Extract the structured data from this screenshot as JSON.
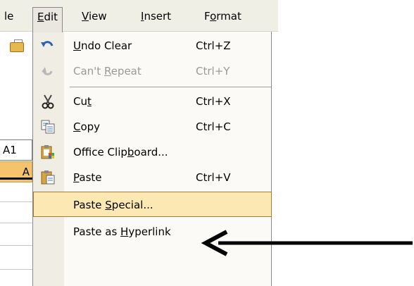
{
  "menubar": {
    "items": [
      {
        "pre": "le",
        "ul": "",
        "post": ""
      },
      {
        "pre": "",
        "ul": "E",
        "post": "dit"
      },
      {
        "pre": "",
        "ul": "V",
        "post": "iew"
      },
      {
        "pre": "",
        "ul": "I",
        "post": "nsert"
      },
      {
        "pre": "F",
        "ul": "o",
        "post": "rmat"
      }
    ]
  },
  "sheet": {
    "name_box": "A1",
    "column_header": "A"
  },
  "menu": {
    "items": [
      {
        "pre": "",
        "ul": "U",
        "post": "ndo Clear",
        "shortcut": "Ctrl+Z",
        "icon": "undo-icon",
        "enabled": true,
        "selected": false
      },
      {
        "pre": "Can't ",
        "ul": "R",
        "post": "epeat",
        "shortcut": "Ctrl+Y",
        "icon": "redo-icon",
        "enabled": false,
        "selected": false
      },
      {
        "pre": "Cu",
        "ul": "t",
        "post": "",
        "shortcut": "Ctrl+X",
        "icon": "scissors-icon",
        "enabled": true,
        "selected": false
      },
      {
        "pre": "",
        "ul": "C",
        "post": "opy",
        "shortcut": "Ctrl+C",
        "icon": "copy-icon",
        "enabled": true,
        "selected": false
      },
      {
        "pre": "Office Clip",
        "ul": "b",
        "post": "oard...",
        "shortcut": "",
        "icon": "office-clipboard-icon",
        "enabled": true,
        "selected": false
      },
      {
        "pre": "",
        "ul": "P",
        "post": "aste",
        "shortcut": "Ctrl+V",
        "icon": "paste-icon",
        "enabled": true,
        "selected": false
      },
      {
        "pre": "Paste ",
        "ul": "S",
        "post": "pecial...",
        "shortcut": "",
        "icon": "",
        "enabled": true,
        "selected": true
      },
      {
        "pre": "Paste as ",
        "ul": "H",
        "post": "yperlink",
        "shortcut": "",
        "icon": "",
        "enabled": true,
        "selected": false
      }
    ]
  },
  "colors": {
    "selection_fill": "#fce8b2",
    "selection_border": "#a67c34",
    "disabled_text": "#9a9a9a",
    "arrow": "#000000"
  }
}
